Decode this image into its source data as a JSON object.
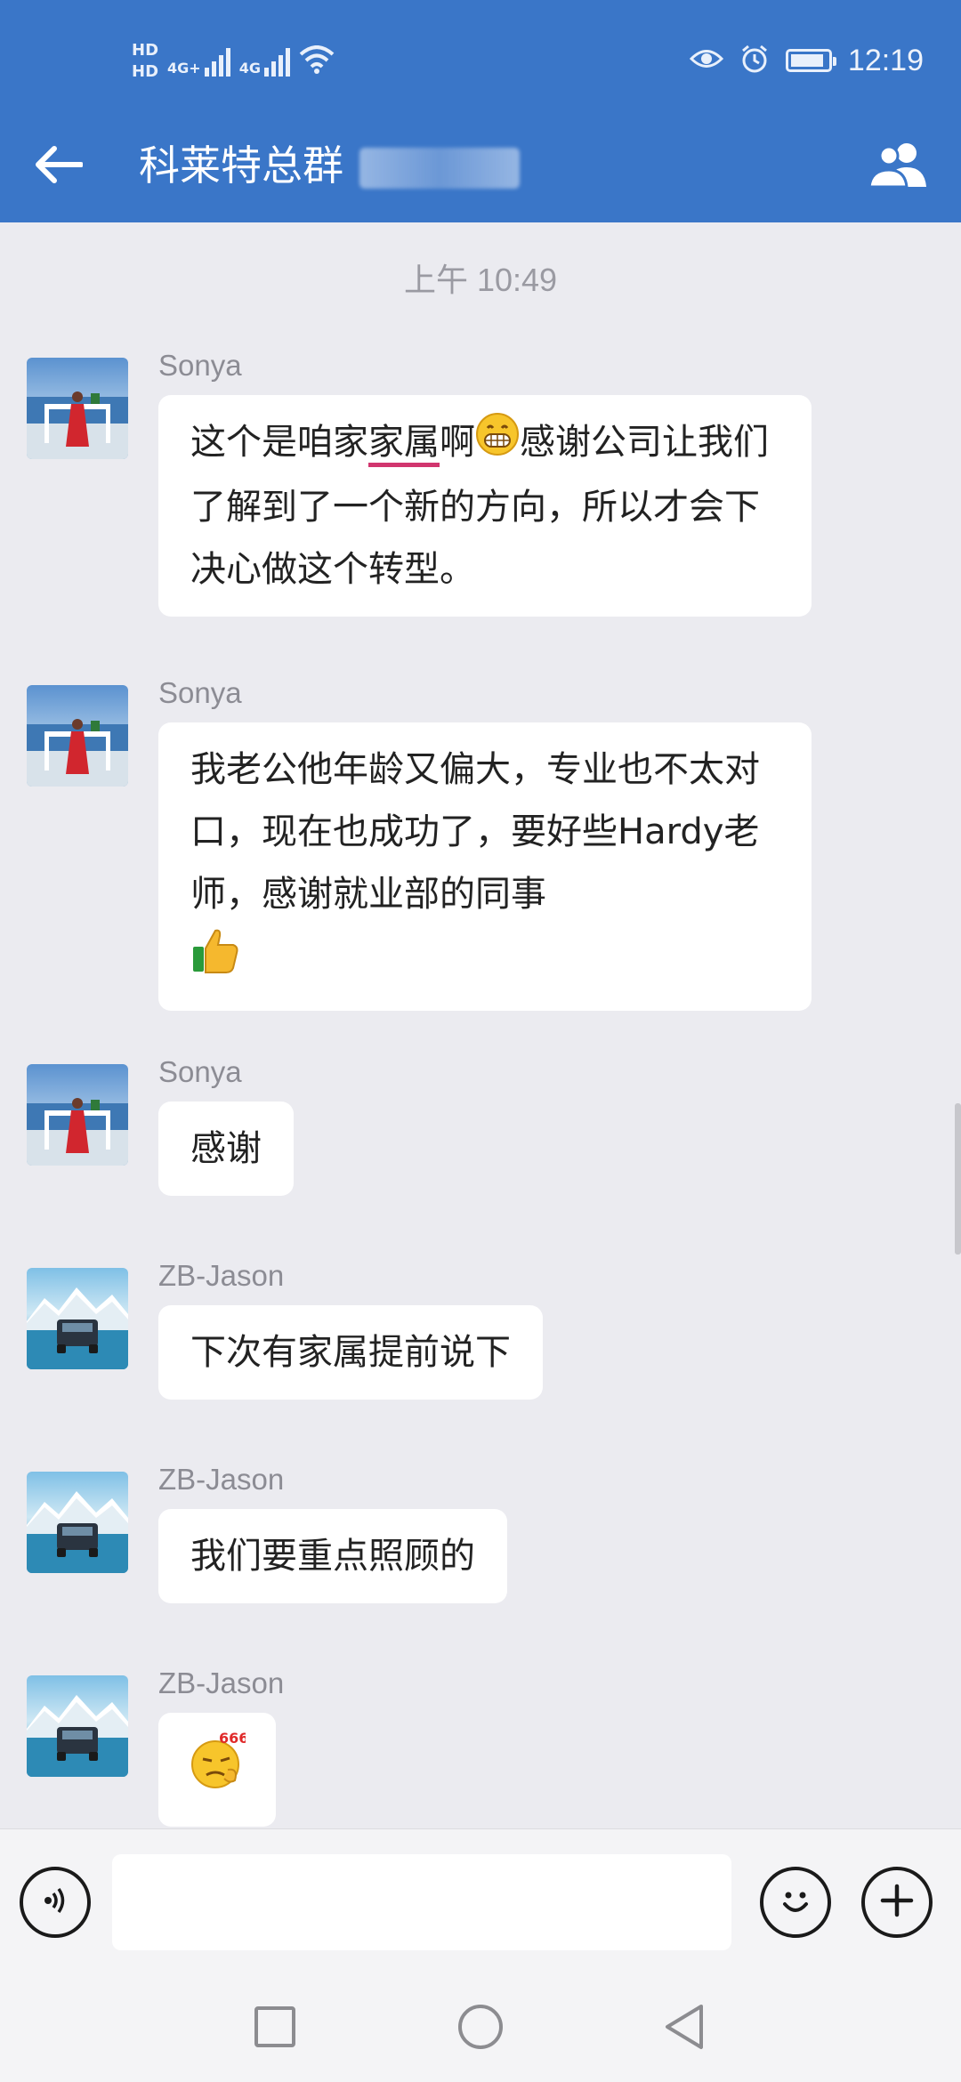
{
  "status_bar": {
    "hd_1": "HD",
    "hd_2": "HD",
    "net_1": "4G+",
    "net_2": "4G",
    "time": "12:19",
    "battery_level": 0.9
  },
  "header": {
    "title": "科莱特总群",
    "back_icon": "arrow-left-icon",
    "members_icon": "group-members-icon"
  },
  "chat": {
    "timestamp": "上午 10:49",
    "messages": [
      {
        "sender": "Sonya",
        "avatar": "avatar-woman-red-dress",
        "segments": {
          "a": "这个是咱家",
          "b": "家属",
          "c": "啊",
          "emoji": "grinning-teeth-emoji",
          "d": "感谢公司让我们了解到了一个新的方向，所以才会下决心做这个转型。"
        }
      },
      {
        "sender": "Sonya",
        "avatar": "avatar-woman-red-dress",
        "text": "我老公他年龄又偏大，专业也不太对口，现在也成功了，要好些Hardy老师，感谢就业部的同事",
        "emoji": "thumbs-up-emoji"
      },
      {
        "sender": "Sonya",
        "avatar": "avatar-woman-red-dress",
        "text": "感谢"
      },
      {
        "sender": "ZB-Jason",
        "avatar": "avatar-car-snow-mountain",
        "text": "下次有家属提前说下"
      },
      {
        "sender": "ZB-Jason",
        "avatar": "avatar-car-snow-mountain",
        "text": "我们要重点照顾的"
      },
      {
        "sender": "ZB-Jason",
        "avatar": "avatar-car-snow-mountain",
        "emoji": "666-emoji",
        "emoji_label": "666"
      }
    ]
  },
  "input_bar": {
    "voice_icon": "voice-input-icon",
    "input_value": "",
    "emoji_icon": "smiley-icon",
    "plus_icon": "plus-icon"
  },
  "navigation": {
    "recents_icon": "square-icon",
    "home_icon": "circle-icon",
    "back_icon": "triangle-back-icon"
  },
  "colors": {
    "header_bg": "#3a76c8",
    "chat_bg": "#ebebf0",
    "bubble_bg": "#ffffff",
    "underline": "#d1356e"
  }
}
